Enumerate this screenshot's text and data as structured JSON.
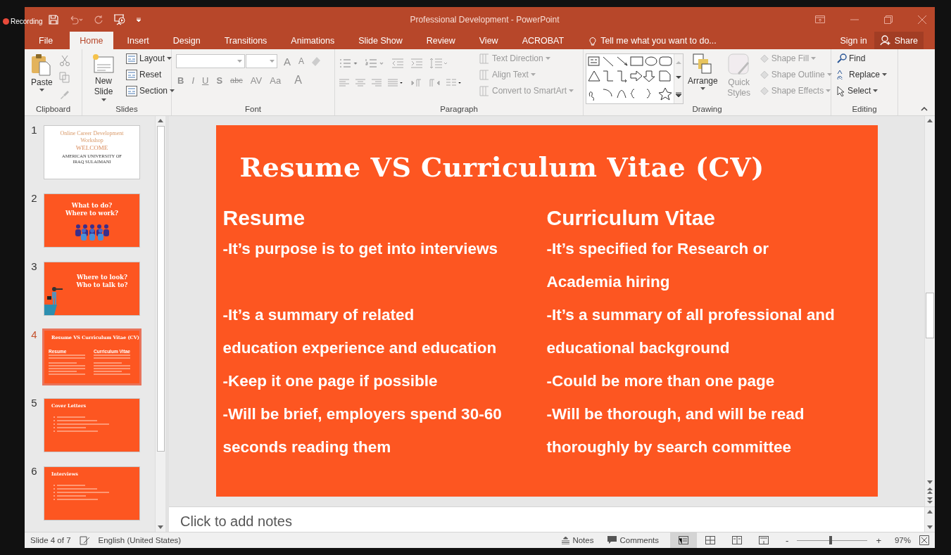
{
  "recording": {
    "label": "Recording"
  },
  "window": {
    "title": "Professional Development - PowerPoint"
  },
  "tabs": [
    {
      "label": "File",
      "selected": false
    },
    {
      "label": "Home",
      "selected": true
    },
    {
      "label": "Insert",
      "selected": false
    },
    {
      "label": "Design",
      "selected": false
    },
    {
      "label": "Transitions",
      "selected": false
    },
    {
      "label": "Animations",
      "selected": false
    },
    {
      "label": "Slide Show",
      "selected": false
    },
    {
      "label": "Review",
      "selected": false
    },
    {
      "label": "View",
      "selected": false
    },
    {
      "label": "ACROBAT",
      "selected": false
    }
  ],
  "tell_me": {
    "placeholder": "Tell me what you want to do..."
  },
  "account": {
    "sign_in": "Sign in",
    "share": "Share"
  },
  "ribbon": {
    "clipboard": {
      "label": "Clipboard",
      "paste": "Paste"
    },
    "slides": {
      "label": "Slides",
      "new_slide": "New Slide",
      "items": [
        {
          "label": "Layout",
          "disabled": false
        },
        {
          "label": "Reset",
          "disabled": false
        },
        {
          "label": "Section",
          "disabled": false
        }
      ]
    },
    "font": {
      "label": "Font",
      "size_buttons": [
        "A",
        "A"
      ],
      "format_buttons": [
        "B",
        "I",
        "U",
        "S",
        "abc",
        "AV",
        "Aa",
        "A"
      ]
    },
    "paragraph": {
      "label": "Paragraph",
      "items": [
        {
          "label": "Text Direction",
          "disabled": true
        },
        {
          "label": "Align Text",
          "disabled": true
        },
        {
          "label": "Convert to SmartArt",
          "disabled": true
        }
      ]
    },
    "drawing": {
      "label": "Drawing",
      "arrange": "Arrange",
      "quick_styles": {
        "label": "Quick Styles",
        "disabled": true
      },
      "items": [
        {
          "label": "Shape Fill",
          "disabled": true
        },
        {
          "label": "Shape Outline",
          "disabled": true
        },
        {
          "label": "Shape Effects",
          "disabled": true
        }
      ]
    },
    "editing": {
      "label": "Editing",
      "items": [
        {
          "label": "Find",
          "disabled": false
        },
        {
          "label": "Replace",
          "disabled": false
        },
        {
          "label": "Select",
          "disabled": false
        }
      ]
    }
  },
  "thumbnails": [
    {
      "number": "1",
      "selected": false,
      "kind": "welcome",
      "title": "Online Career Development Workshop",
      "subtitle": "WELCOME",
      "footer": "AMERICAN UNIVERSITY OF IRAQ SULAIMANI"
    },
    {
      "number": "2",
      "selected": false,
      "kind": "people",
      "title": "What to do? Where to work?"
    },
    {
      "number": "3",
      "selected": false,
      "kind": "lookout",
      "title": "Where to look? Who to talk to?"
    },
    {
      "number": "4",
      "selected": true,
      "kind": "two_column",
      "title": "Resume VS Curriculum Vitae (CV)",
      "headings": [
        "Resume",
        "Curriculum Vitae"
      ]
    },
    {
      "number": "5",
      "selected": false,
      "kind": "bullets",
      "title": "Cover Letters"
    },
    {
      "number": "6",
      "selected": false,
      "kind": "bullets",
      "title": "Interviews"
    }
  ],
  "slide": {
    "title": "Resume VS Curriculum Vitae (CV)",
    "columns": [
      {
        "heading": "Resume",
        "paragraphs": [
          {
            "lines": [
              "-It’s purpose is to get into interviews"
            ],
            "space_after": true
          },
          {
            "lines": [
              "-It’s a summary of related",
              "education experience and education"
            ],
            "space_after": false
          },
          {
            "lines": [
              "-Keep it one page if possible"
            ],
            "space_after": false
          },
          {
            "lines": [
              "-Will be brief, employers spend 30-60",
              "seconds reading them"
            ],
            "space_after": false
          }
        ]
      },
      {
        "heading": "Curriculum Vitae",
        "paragraphs": [
          {
            "lines": [
              "-It’s specified for Research or",
              "Academia hiring"
            ],
            "space_after": false
          },
          {
            "lines": [
              "-It’s a summary of all professional and",
              "educational background"
            ],
            "space_after": false
          },
          {
            "lines": [
              "-Could be more than one page"
            ],
            "space_after": false
          },
          {
            "lines": [
              "-Will be thorough, and will be read",
              "thoroughly by search committee"
            ],
            "space_after": false
          }
        ]
      }
    ]
  },
  "notes": {
    "placeholder": "Click to add notes"
  },
  "status_bar": {
    "slide": "Slide 4 of 7",
    "language": "English (United States)",
    "notes": "Notes",
    "comments": "Comments",
    "views": [
      {
        "selected": true
      },
      {
        "selected": false
      },
      {
        "selected": false
      },
      {
        "selected": false
      }
    ],
    "zoom_out": "-",
    "zoom_in": "+",
    "zoom": {
      "level": 0.48
    },
    "zoom_reading": "97%"
  }
}
